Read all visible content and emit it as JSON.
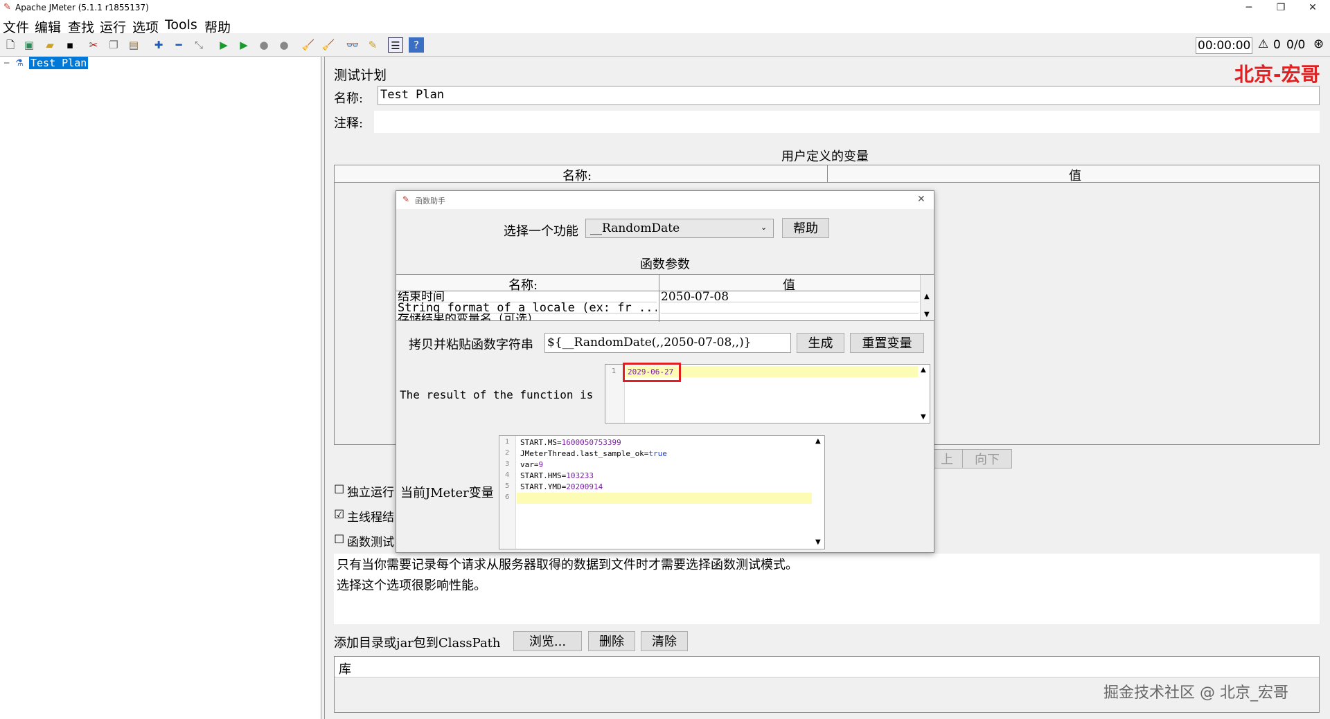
{
  "window": {
    "title": "Apache JMeter (5.1.1 r1855137)",
    "controls": [
      "─",
      "❐",
      "✕"
    ]
  },
  "menu": [
    "文件",
    "编辑",
    "查找",
    "运行",
    "选项",
    "Tools",
    "帮助"
  ],
  "toolbar": {
    "timer": "00:00:00",
    "warn_count": "0",
    "thread_count": "0/0"
  },
  "tree": {
    "root": "Test Plan"
  },
  "panel": {
    "title": "测试计划",
    "watermark_top": "北京-宏哥",
    "name_label": "名称:",
    "name_value": "Test Plan",
    "comment_label": "注释:",
    "vars_title": "用户定义的变量",
    "vars_col_name": "名称:",
    "vars_col_value": "值",
    "btn_up_partial": "上",
    "btn_down": "向下",
    "check_independent": "独立运行",
    "check_main": "主线程结",
    "check_function": "函数测试",
    "desc_line1": "只有当你需要记录每个请求从服务器取得的数据到文件时才需要选择函数测试模式。",
    "desc_line2": "选择这个选项很影响性能。",
    "classpath_label": "添加目录或jar包到ClassPath",
    "btn_browse": "浏览...",
    "btn_delete": "删除",
    "btn_clear": "清除",
    "lib_label": "库",
    "watermark_bottom": "掘金技术社区 @ 北京_宏哥"
  },
  "dialog": {
    "title": "函数助手",
    "close": "✕",
    "select_label": "选择一个功能",
    "select_value": "__RandomDate",
    "help_btn": "帮助",
    "params_title": "函数参数",
    "col_name": "名称:",
    "col_value": "值",
    "rows": [
      {
        "name": "结束时间",
        "value": "2050-07-08"
      },
      {
        "name": "String format of a locale (ex: fr ...",
        "value": ""
      },
      {
        "name": "存储结果的变量名（可选）",
        "value": ""
      }
    ],
    "copy_label": "拷贝并粘贴函数字符串",
    "copy_value": "${__RandomDate(,,2050-07-08,,)}",
    "btn_generate": "生成",
    "btn_reset": "重置变量",
    "result_label": "The result of the function is",
    "result_line_no": "1",
    "result_value": "2029-06-27",
    "vars_label": "当前JMeter变量",
    "var_lines": [
      {
        "n": "1",
        "k": "START.MS=",
        "v": "1600050753399"
      },
      {
        "n": "2",
        "k": "JMeterThread.last_sample_ok=",
        "v": "true"
      },
      {
        "n": "3",
        "k": "var=",
        "v": "9"
      },
      {
        "n": "4",
        "k": "START.HMS=",
        "v": "103233"
      },
      {
        "n": "5",
        "k": "START.YMD=",
        "v": "20200914"
      },
      {
        "n": "6",
        "k": "",
        "v": ""
      }
    ]
  },
  "colors": {
    "selection": "#0078d7",
    "highlight": "#fdfcb4",
    "red_box": "#e02020",
    "watermark": "#e02020"
  }
}
